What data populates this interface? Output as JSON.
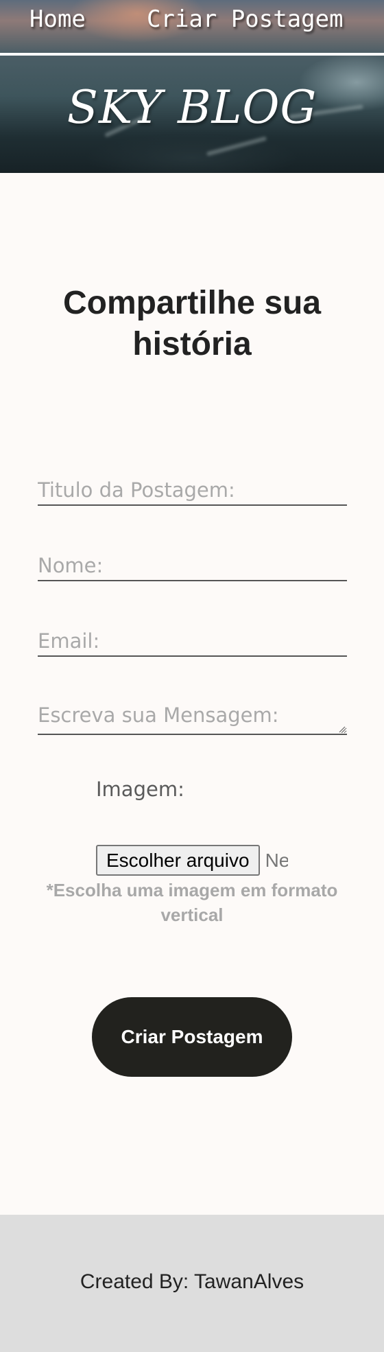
{
  "nav": {
    "home_label": "Home",
    "create_label": "Criar Postagem"
  },
  "brand": {
    "title": "SKY BLOG"
  },
  "main": {
    "title": "Compartilhe sua história",
    "fields": {
      "title_placeholder": "Titulo da Postagem:",
      "name_placeholder": "Nome:",
      "email_placeholder": "Email:",
      "message_placeholder": "Escreva sua Mensagem:"
    },
    "image_label": "Imagem:",
    "file_button_label": "Escolher arquivo",
    "file_status": "Nenhum arquivo escolhido",
    "file_hint": "*Escolha uma imagem em formato vertical",
    "submit_label": "Criar Postagem"
  },
  "footer": {
    "credit": "Created By: TawanAlves"
  },
  "colors": {
    "background": "#fdfaf8",
    "submit_button": "#22221e",
    "footer_background": "#dddddd",
    "hint_text": "#a8a8a8"
  }
}
